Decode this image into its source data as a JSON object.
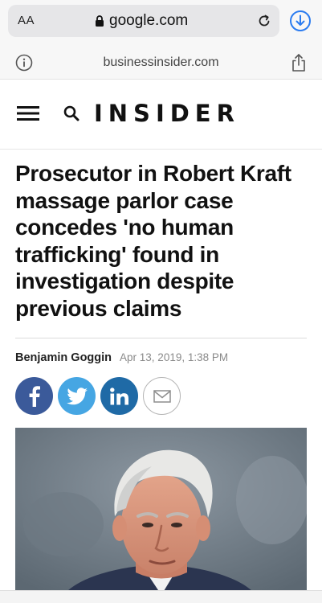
{
  "browser": {
    "text_size_label": "AA",
    "domain": "google.com"
  },
  "amp_bar": {
    "source_domain": "businessinsider.com"
  },
  "site": {
    "brand": "INSIDER"
  },
  "article": {
    "headline": "Prosecutor in Robert Kraft massage parlor case concedes 'no human trafficking' found in investigation despite previous claims",
    "author": "Benjamin Goggin",
    "date": "Apr 13, 2019, 1:38 PM"
  },
  "share_buttons": [
    {
      "name": "facebook",
      "color": "#3b5a9a"
    },
    {
      "name": "twitter",
      "color": "#46a6e3"
    },
    {
      "name": "linkedin",
      "color": "#1f6aa6"
    },
    {
      "name": "email",
      "color": "#ffffff"
    }
  ],
  "icons": {
    "lock": "lock-icon",
    "reload": "reload-icon",
    "download": "download-icon",
    "info": "info-icon",
    "share": "share-icon",
    "menu": "hamburger-menu-icon",
    "search": "search-icon"
  }
}
